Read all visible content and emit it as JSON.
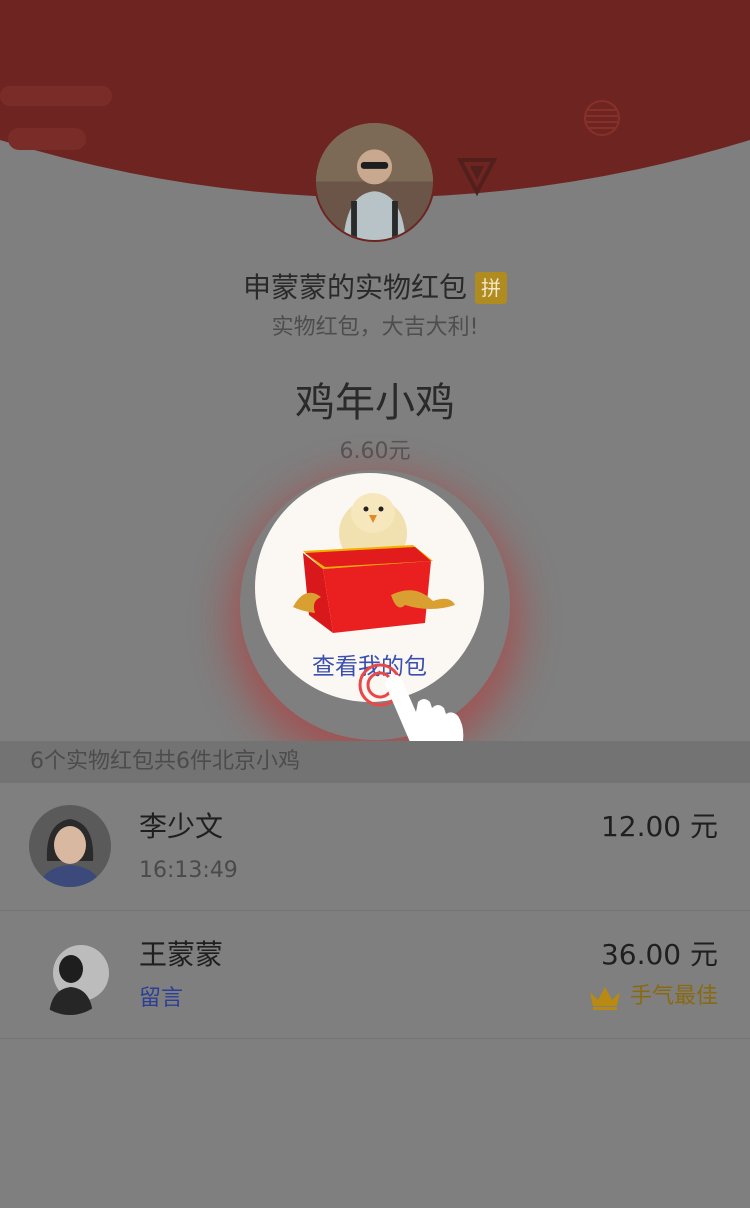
{
  "header": {
    "sender_title": "申蒙蒙的实物红包",
    "badge": "拼",
    "blessing": "实物红包，大吉大利!"
  },
  "gift": {
    "name": "鸡年小鸡",
    "price": "6.60元",
    "reveal_label": "查看我的包"
  },
  "summary": {
    "text": "6个实物红包共6件北京小鸡"
  },
  "recipients": [
    {
      "name": "李少文",
      "meta": "16:13:49",
      "amount": "12.00 元"
    },
    {
      "name": "王蒙蒙",
      "meta": "留言",
      "amount": "36.00 元",
      "best_label": "手气最佳"
    }
  ],
  "colors": {
    "header_red": "#6e2521",
    "badge_gold": "#b08b20",
    "link_blue": "#2c3f95",
    "best_gold": "#8a6a10"
  },
  "icons": {
    "crown": "crown-icon",
    "hand": "tap-hand-icon"
  }
}
